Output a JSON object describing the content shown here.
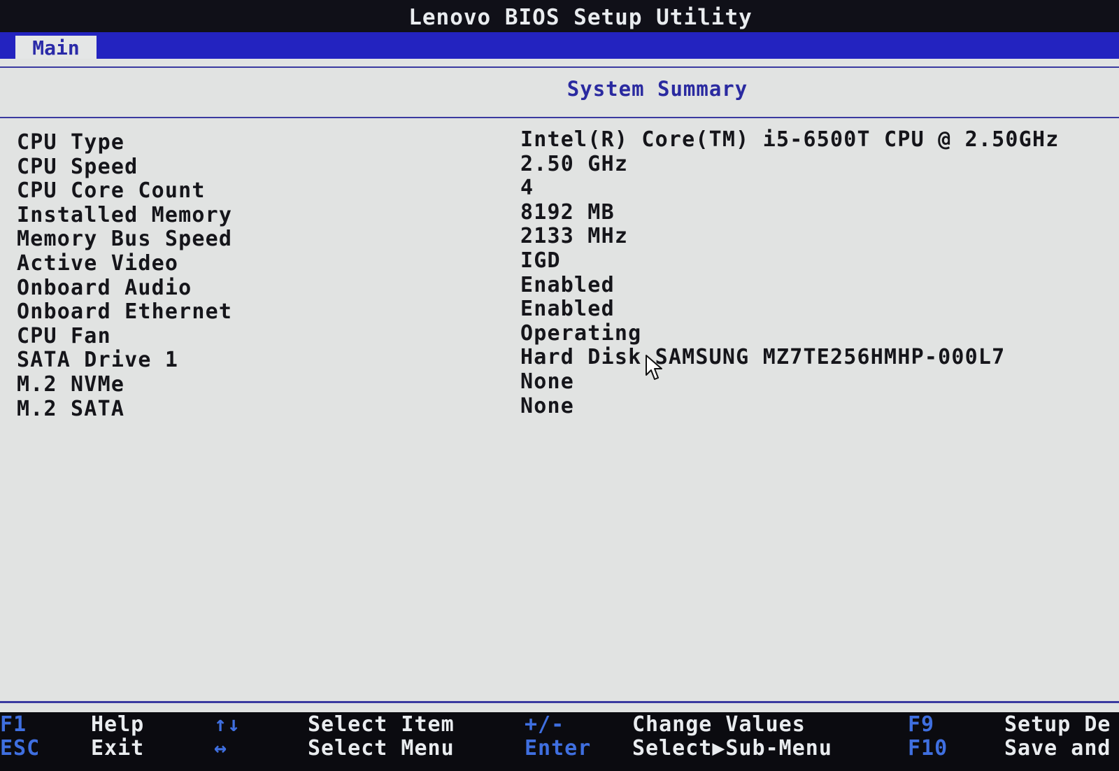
{
  "window": {
    "title": "Lenovo BIOS Setup Utility"
  },
  "menu": {
    "tabs": [
      {
        "label": "Main",
        "active": true
      }
    ]
  },
  "section": {
    "title": "System Summary"
  },
  "summary": {
    "rows": [
      {
        "label": "CPU Type",
        "value": "Intel(R) Core(TM) i5-6500T CPU @ 2.50GHz"
      },
      {
        "label": "CPU Speed",
        "value": "2.50 GHz"
      },
      {
        "label": "CPU Core Count",
        "value": "4"
      },
      {
        "label": "Installed Memory",
        "value": "8192 MB"
      },
      {
        "label": "Memory Bus Speed",
        "value": "2133 MHz"
      },
      {
        "label": "Active Video",
        "value": "IGD"
      },
      {
        "label": "Onboard Audio",
        "value": "Enabled"
      },
      {
        "label": "Onboard Ethernet",
        "value": "Enabled"
      },
      {
        "label": "CPU Fan",
        "value": "Operating"
      },
      {
        "label": "SATA Drive 1",
        "value": "Hard Disk SAMSUNG MZ7TE256HMHP-000L7"
      },
      {
        "label": "M.2 NVMe",
        "value": "None"
      },
      {
        "label": "M.2 SATA",
        "value": "None"
      }
    ]
  },
  "footer": {
    "f1_key": "F1",
    "f1_desc": "Help",
    "esc_key": "ESC",
    "esc_desc": "Exit",
    "updown_key": "↑↓",
    "updown_desc": "Select Item",
    "leftright_key": "↔",
    "leftright_desc": "Select Menu",
    "plusminus_key": "+/-",
    "plusminus_desc": "Change Values",
    "enter_key": "Enter",
    "enter_desc": "Select▶Sub-Menu",
    "f9_key": "F9",
    "f9_desc": "Setup De",
    "f10_key": "F10",
    "f10_desc": "Save and"
  },
  "colors": {
    "menu_bar": "#2323c0",
    "background": "#e1e3e2",
    "accent_text": "#2a2aa0",
    "footer_key": "#3f6fe0"
  },
  "icons": {
    "pointer": "mouse-pointer-icon"
  }
}
